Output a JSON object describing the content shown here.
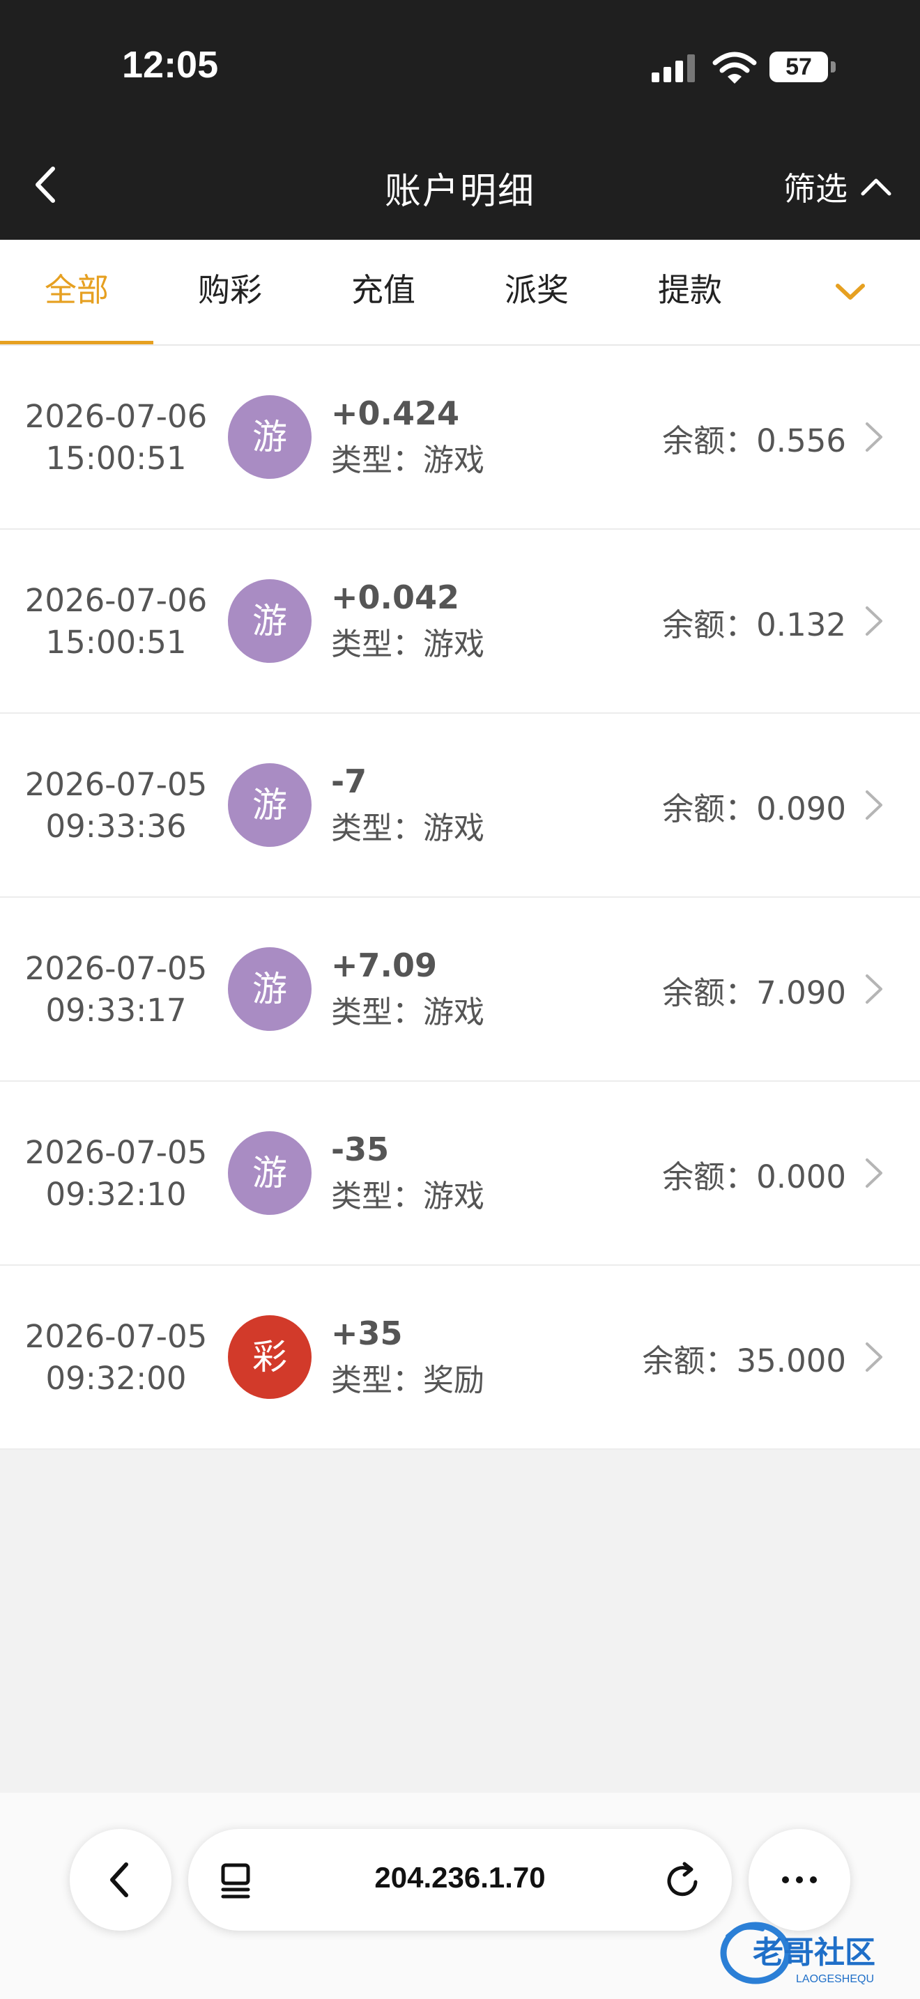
{
  "status_bar": {
    "time": "12:05",
    "battery": "57"
  },
  "nav": {
    "title": "账户明细",
    "filter_label": "筛选"
  },
  "tabs": [
    {
      "label": "全部",
      "active": true
    },
    {
      "label": "购彩",
      "active": false
    },
    {
      "label": "充值",
      "active": false
    },
    {
      "label": "派奖",
      "active": false
    },
    {
      "label": "提款",
      "active": false
    }
  ],
  "colors": {
    "accent": "#e6a021",
    "game_badge": "#a98cc3",
    "lottery_badge": "#d23a2a",
    "dark_bar": "#1f1f1f"
  },
  "records": [
    {
      "date": "2026-07-06",
      "time": "15:00:51",
      "badge": "游",
      "badge_kind": "game",
      "amount": "+0.424",
      "type": "类型：游戏",
      "balance": "余额：0.556"
    },
    {
      "date": "2026-07-06",
      "time": "15:00:51",
      "badge": "游",
      "badge_kind": "game",
      "amount": "+0.042",
      "type": "类型：游戏",
      "balance": "余额：0.132"
    },
    {
      "date": "2026-07-05",
      "time": "09:33:36",
      "badge": "游",
      "badge_kind": "game",
      "amount": "-7",
      "type": "类型：游戏",
      "balance": "余额：0.090"
    },
    {
      "date": "2026-07-05",
      "time": "09:33:17",
      "badge": "游",
      "badge_kind": "game",
      "amount": "+7.09",
      "type": "类型：游戏",
      "balance": "余额：7.090"
    },
    {
      "date": "2026-07-05",
      "time": "09:32:10",
      "badge": "游",
      "badge_kind": "game",
      "amount": "-35",
      "type": "类型：游戏",
      "balance": "余额：0.000"
    },
    {
      "date": "2026-07-05",
      "time": "09:32:00",
      "badge": "彩",
      "badge_kind": "lottery",
      "amount": "+35",
      "type": "类型：奖励",
      "balance": "余额：35.000"
    }
  ],
  "browser": {
    "url": "204.236.1.70"
  },
  "watermark": {
    "text": "老哥社区",
    "subtext": "LAOGESHEQU"
  }
}
